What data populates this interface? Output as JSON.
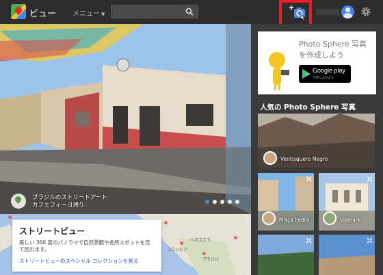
{
  "header": {
    "app_title": "ビュー",
    "menu_label": "メニュー",
    "search_placeholder": ""
  },
  "hero": {
    "caption_line1": "ブラジルのストリートアート",
    "caption_line2": "カフェフィーヨ通り",
    "dot_count": 5,
    "active_dot": 0
  },
  "streetview_card": {
    "title": "ストリートビュー",
    "description": "美しい 360 度のパノラマで自然景観や名所スポットを見て回れます。",
    "link": "ストリートビューのスペシャル コレクションを見る"
  },
  "map": {
    "labels": [
      "ベネズエラ",
      "コロンビア",
      "ブラジル"
    ]
  },
  "panel": {
    "promo_title": "Photo Sphere 写真を作成しよう",
    "gplay_label": "Google play",
    "gplay_sub": "で手に入れよう",
    "popular_heading": "人気の Photo Sphere 写真",
    "tiles": [
      {
        "name": "Ventisquero Negro"
      },
      {
        "name": "Praça Pedro"
      },
      {
        "name": "Vismark"
      }
    ]
  },
  "colors": {
    "topbar": "#2d2d2d",
    "highlight": "#ee1c24",
    "accent_blue": "#4a86e8"
  },
  "icons": [
    "search-icon",
    "camera-add-icon",
    "avatar-icon",
    "gear-icon",
    "photo-sphere-icon",
    "map-pin-icon"
  ]
}
